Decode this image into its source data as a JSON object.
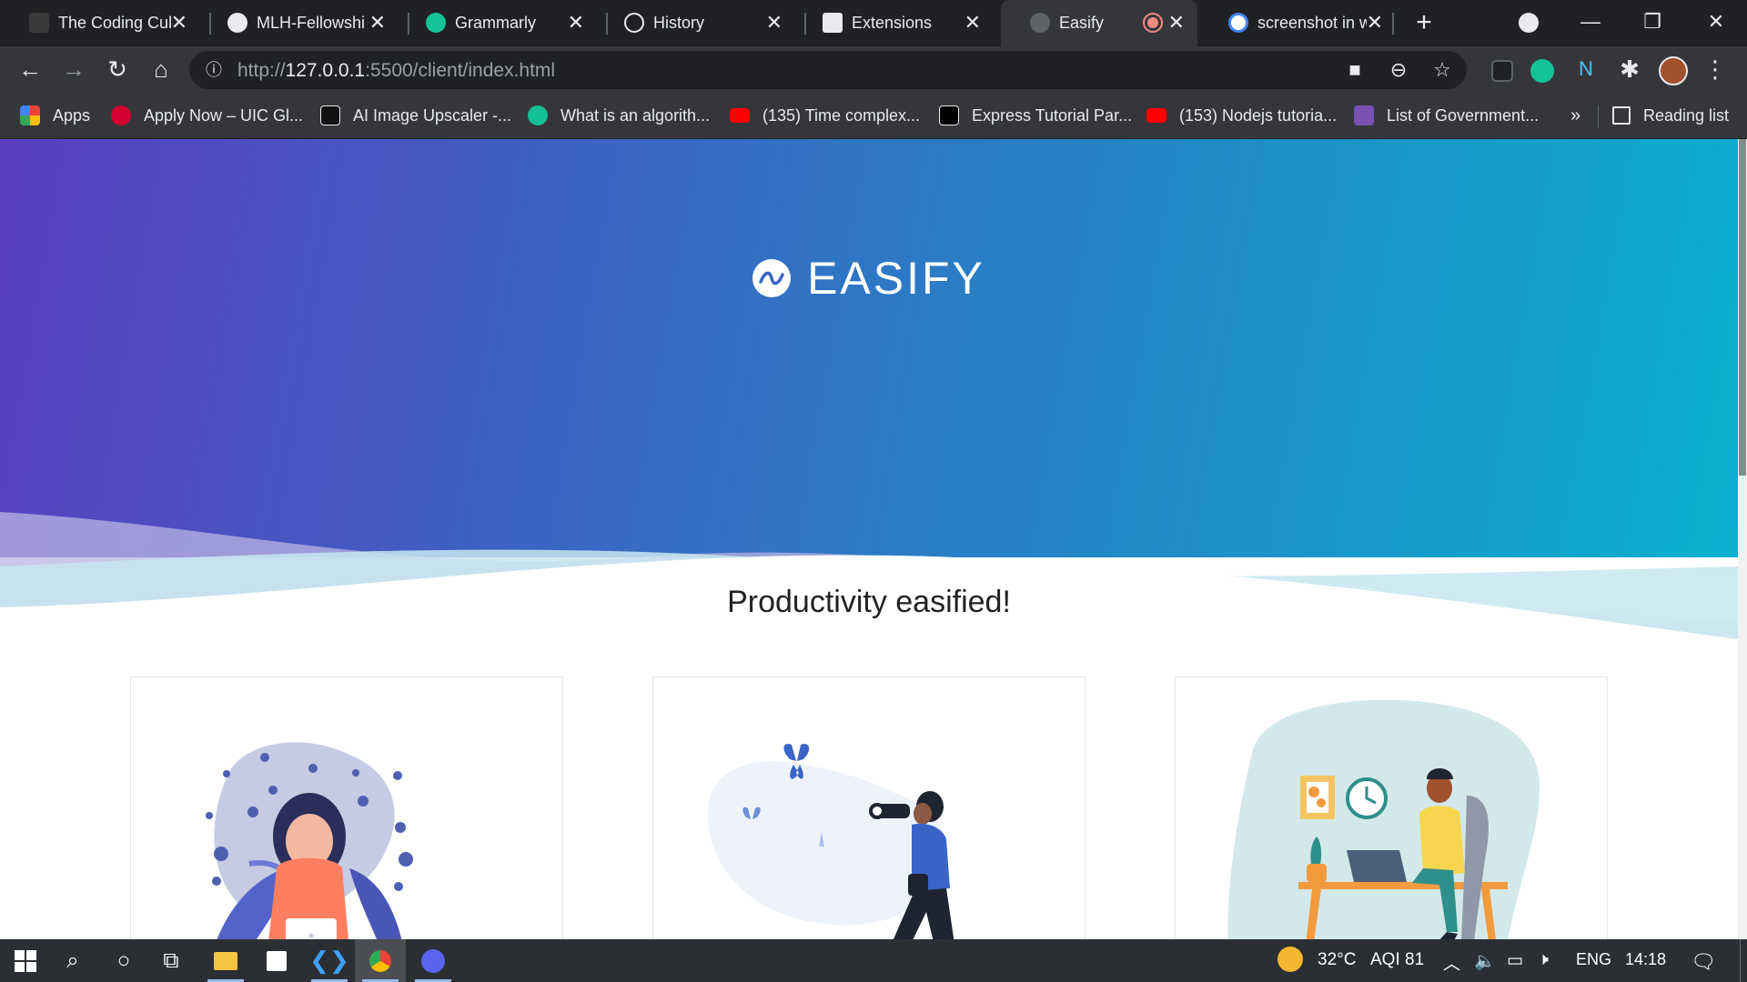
{
  "tabs": [
    {
      "label": "The Coding Cul",
      "favicon": "lock-hat-icon"
    },
    {
      "label": "MLH-Fellowshi",
      "favicon": "github-icon"
    },
    {
      "label": "Grammarly",
      "favicon": "grammarly-icon"
    },
    {
      "label": "History",
      "favicon": "history-icon"
    },
    {
      "label": "Extensions",
      "favicon": "puzzle-icon"
    },
    {
      "label": "Easify",
      "favicon": "globe-icon",
      "active": true
    },
    {
      "label": "screenshot in w",
      "favicon": "google-icon"
    }
  ],
  "address_bar": {
    "url_prefix": "http://",
    "url_host": "127.0.0.1",
    "url_rest": ":5500/client/index.html"
  },
  "bookmarks": [
    {
      "label": "Apps",
      "icon": "apps-grid-icon",
      "color": "#ea4335"
    },
    {
      "label": "Apply Now – UIC Gl...",
      "icon": "uic-icon",
      "color": "#d50032"
    },
    {
      "label": "AI Image Upscaler -...",
      "icon": "upscaler-icon",
      "color": "#111111"
    },
    {
      "label": "What is an algorith...",
      "icon": "khan-icon",
      "color": "#14bf96"
    },
    {
      "label": "(135) Time complex...",
      "icon": "youtube-icon",
      "color": "#ff0000"
    },
    {
      "label": "Express Tutorial Par...",
      "icon": "mdn-icon",
      "color": "#000000"
    },
    {
      "label": "(153) Nodejs tutoria...",
      "icon": "youtube-icon",
      "color": "#ff0000"
    },
    {
      "label": "List of Government...",
      "icon": "bootstrap-icon",
      "color": "#7952b3"
    }
  ],
  "bookmarks_more": "»",
  "reading_list": "Reading list",
  "page": {
    "brand": "EASIFY",
    "tagline": "Productivity easified!",
    "cards": [
      {
        "illustration": "meditating-woman-illustration"
      },
      {
        "illustration": "photographer-butterflies-illustration"
      },
      {
        "illustration": "man-at-desk-illustration"
      }
    ]
  },
  "taskbar": {
    "weather": "32°C",
    "aqi": "AQI 81",
    "language": "ENG",
    "time": "14:18"
  },
  "colors": {
    "hero_start": "#5a3fbf",
    "hero_end": "#0bb0cf",
    "chrome_dark": "#202124",
    "chrome_mid": "#35363a"
  }
}
